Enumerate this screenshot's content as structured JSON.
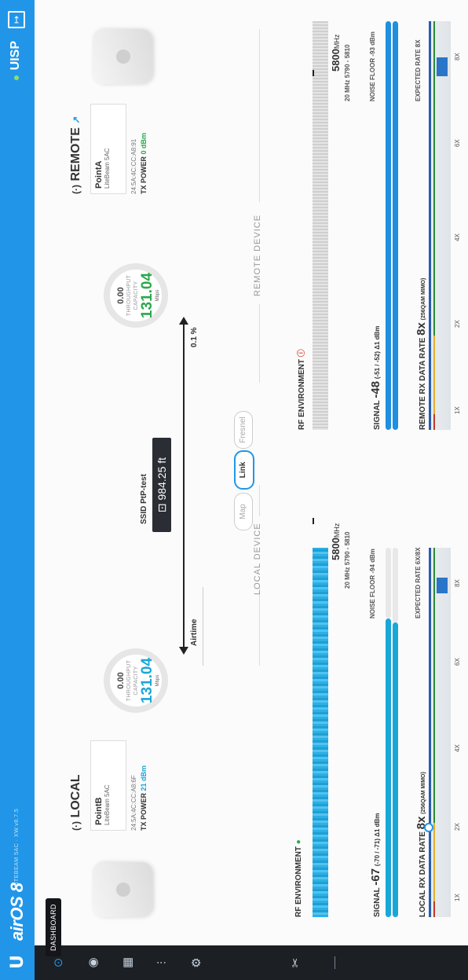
{
  "header": {
    "logo": "U",
    "brand": "airOS 8",
    "subtitle": "LITEBEAM 5AC · XW.v8.7.5",
    "platform": "UISP",
    "tooltip": "DASHBOARD"
  },
  "nav": [
    {
      "name": "dashboard",
      "icon": "⊙"
    },
    {
      "name": "wireless",
      "icon": "◉"
    },
    {
      "name": "network",
      "icon": "▦"
    },
    {
      "name": "services",
      "icon": "⫶"
    },
    {
      "name": "system",
      "icon": "⚙"
    },
    {
      "name": "tools",
      "icon": "✂"
    }
  ],
  "local": {
    "title": "LOCAL",
    "name": "PointB",
    "model": "LiteBeam 5AC",
    "mac": "24:5A:4C:CC:A8:6F",
    "tx_label": "TX POWER",
    "tx_value": "21 dBm",
    "throughput": "0.00",
    "throughput_label": "THROUGHPUT",
    "capacity_label": "CAPACITY",
    "capacity": "131.04",
    "unit": "Mbps",
    "section": "LOCAL DEVICE"
  },
  "remote": {
    "title": "REMOTE",
    "name": "PointA",
    "model": "LiteBeam 5AC",
    "mac": "24:5A:4C:CC:A8:91",
    "tx_label": "TX POWER",
    "tx_value": "0 dBm",
    "throughput": "0.00",
    "throughput_label": "THROUGHPUT",
    "capacity_label": "CAPACITY",
    "capacity": "131.04",
    "unit": "Mbps",
    "section": "REMOTE DEVICE"
  },
  "link": {
    "ssid_label": "SSID",
    "ssid": "PtP-test",
    "distance": "984.25 ft",
    "airtime_label": "Airtime",
    "airtime_value": "0.1 %",
    "tabs": [
      "Map",
      "Link",
      "Fresnel"
    ]
  },
  "rf_local": {
    "title": "RF ENVIRONMENT",
    "freq": "5800",
    "freq_unit": "MHz",
    "channel": "20 MHz 5790 - 5810",
    "signal_label": "SIGNAL",
    "signal": "-67",
    "signal_detail": "(-70 / -71) Δ1 dBm",
    "noise": "NOISE FLOOR -94 dBm",
    "rate_label": "LOCAL RX DATA RATE",
    "rate": "8x",
    "rate_detail": "(256QAM MIMO)",
    "expected": "EXPECTED RATE 6X/8X",
    "ticks": [
      "1X",
      "2X",
      "4X",
      "6X",
      "8X"
    ]
  },
  "rf_remote": {
    "title": "RF ENVIRONMENT",
    "freq": "5800",
    "freq_unit": "MHz",
    "channel": "20 MHz 5790 - 5810",
    "signal_label": "SIGNAL",
    "signal": "-48",
    "signal_detail": "(-51 / -52) Δ1 dBm",
    "noise": "NOISE FLOOR -93 dBm",
    "rate_label": "REMOTE RX DATA RATE",
    "rate": "8x",
    "rate_detail": "(256QAM MIMO)",
    "expected": "EXPECTED RATE 8X",
    "ticks": [
      "1X",
      "2X",
      "4X",
      "6X",
      "8X"
    ]
  },
  "colors": {
    "accent": "#2196e8",
    "cyan": "#19a7d8",
    "green": "#2aa84a",
    "rail": "#1c1f24"
  }
}
